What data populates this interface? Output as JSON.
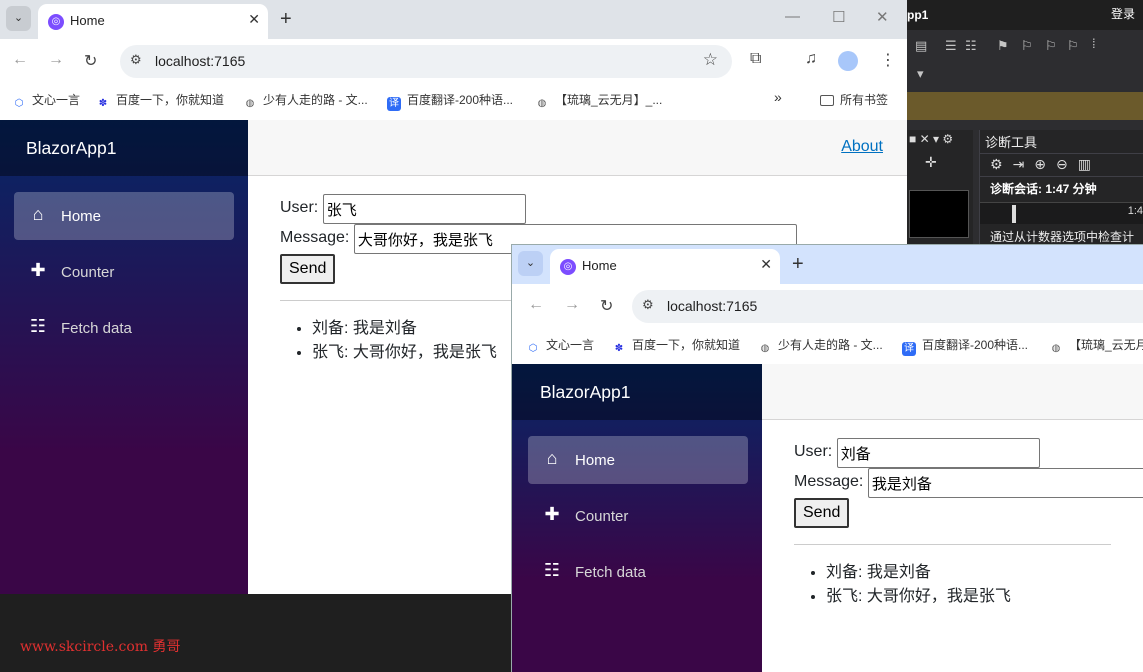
{
  "vs": {
    "title_fragment": "pp1",
    "login": "登录",
    "diag_title": "诊断工具",
    "session": "诊断会话: 1:47 分钟",
    "time_tick": "1:4",
    "note": "通过从计数器选项中检查计"
  },
  "browser_front": {
    "tab_title": "Home",
    "url": "localhost:7165",
    "bookmarks": [
      "文心一言",
      "百度一下，你就知道",
      "少有人走的路 - 文...",
      "百度翻译-200种语...",
      "【琉璃_云无月】_..."
    ],
    "all_bookmarks": "所有书签",
    "more": "»",
    "app": {
      "brand": "BlazorApp1",
      "nav": [
        {
          "label": "Home",
          "icon": "home-icon"
        },
        {
          "label": "Counter",
          "icon": "plus-icon"
        },
        {
          "label": "Fetch data",
          "icon": "list-icon"
        }
      ],
      "about": "About",
      "user_label": "User:",
      "user_value": "张飞",
      "message_label": "Message:",
      "message_value": "大哥你好，我是张飞",
      "send": "Send",
      "messages": [
        "刘备: 我是刘备",
        "张飞: 大哥你好，我是张飞"
      ]
    }
  },
  "browser_back": {
    "tab_title": "Home",
    "url": "localhost:7165",
    "bookmarks": [
      "文心一言",
      "百度一下，你就知道",
      "少有人走的路 - 文...",
      "百度翻译-200种语...",
      "【琉璃_云无月"
    ],
    "app": {
      "brand": "BlazorApp1",
      "nav": [
        {
          "label": "Home",
          "icon": "home-icon"
        },
        {
          "label": "Counter",
          "icon": "plus-icon"
        },
        {
          "label": "Fetch data",
          "icon": "list-icon"
        }
      ],
      "user_label": "User:",
      "user_value": "刘备",
      "message_label": "Message:",
      "message_value": "我是刘备",
      "send": "Send",
      "messages": [
        "刘备: 我是刘备",
        "张飞: 大哥你好，我是张飞"
      ]
    }
  },
  "watermark": "www.skcircle.com 勇哥"
}
